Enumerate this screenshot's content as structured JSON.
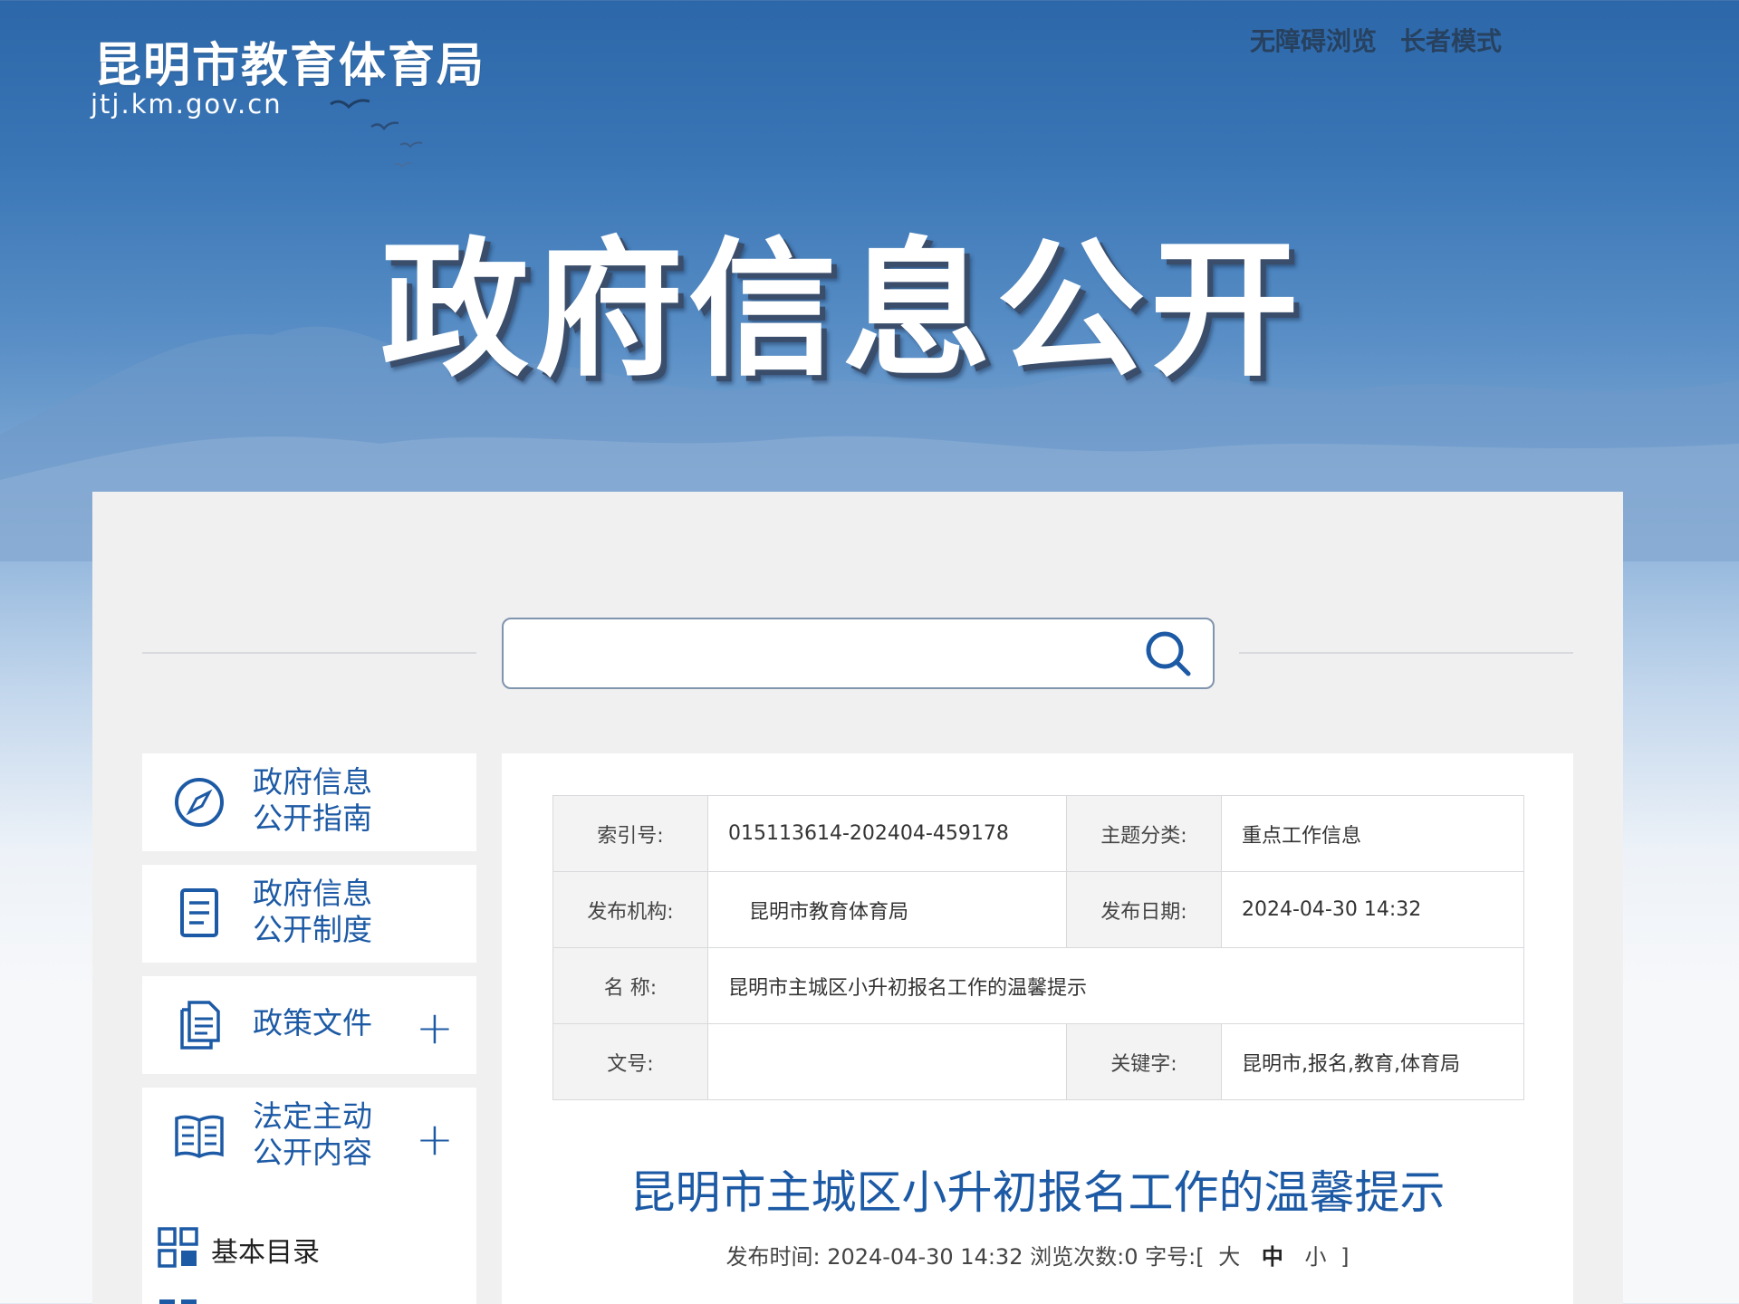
{
  "header": {
    "site_title": "昆明市教育体育局",
    "site_domain": "jtj.km.gov.cn",
    "links": [
      "无障碍浏览",
      "长者模式"
    ],
    "banner_title": "政府信息公开"
  },
  "search": {
    "placeholder": ""
  },
  "sidebar": {
    "items": [
      {
        "label_line1": "政府信息",
        "label_line2": "公开指南",
        "icon": "compass-icon",
        "expandable": false
      },
      {
        "label_line1": "政府信息",
        "label_line2": "公开制度",
        "icon": "document-icon",
        "expandable": false
      },
      {
        "label_line1": "政策文件",
        "label_line2": "",
        "icon": "files-icon",
        "expandable": true
      },
      {
        "label_line1": "法定主动",
        "label_line2": "公开内容",
        "icon": "book-icon",
        "expandable": true
      }
    ],
    "expand_symbol": "+",
    "sub_items": [
      {
        "label": "基本目录",
        "icon": "grid-icon"
      }
    ]
  },
  "meta": {
    "index_no_label": "索引号:",
    "index_no": "015113614-202404-459178",
    "topic_label": "主题分类:",
    "topic": "重点工作信息",
    "publisher_label": "发布机构:",
    "publisher": "昆明市教育体育局",
    "pub_date_label": "发布日期:",
    "pub_date": "2024-04-30 14:32",
    "name_label": "名 称:",
    "name": "昆明市主城区小升初报名工作的温馨提示",
    "doc_no_label": "文号:",
    "doc_no": "",
    "keywords_label": "关键字:",
    "keywords": "昆明市,报名,教育,体育局"
  },
  "article": {
    "title": "昆明市主城区小升初报名工作的温馨提示",
    "info_prefix": "发布时间:",
    "info_time": "2024-04-30 14:32",
    "views_label": "浏览次数:",
    "views": "0",
    "font_label": "字号:",
    "bracket_open": "[",
    "font_large": "大",
    "font_medium": "中",
    "font_small": "小",
    "bracket_close": "]"
  },
  "colors": {
    "accent": "#1d5aa5",
    "banner": "#2c67a9",
    "panel": "#f0f0f1"
  }
}
